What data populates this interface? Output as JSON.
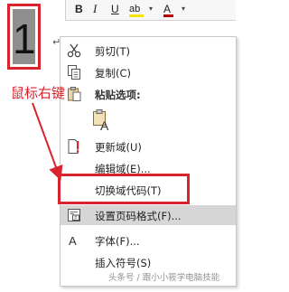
{
  "document": {
    "page_number": "1",
    "para_mark": "↵"
  },
  "mini_toolbar": {
    "bold": "B",
    "italic": "I",
    "underline": "U",
    "highlight": "ab",
    "dropdown": "▾",
    "font_color": "A"
  },
  "context_menu": {
    "items": [
      {
        "label": "剪切(T)",
        "icon": "scissors-icon"
      },
      {
        "label": "复制(C)",
        "icon": "copy-icon"
      },
      {
        "label": "粘贴选项:",
        "icon": "paste-icon"
      },
      {
        "label": "更新域(U)",
        "icon": "update-field-icon"
      },
      {
        "label": "编辑域(E)...",
        "icon": ""
      },
      {
        "label": "切换域代码(T)",
        "icon": ""
      },
      {
        "label": "设置页码格式(F)...",
        "icon": "page-number-format-icon"
      },
      {
        "label": "字体(F)...",
        "icon": "font-icon"
      },
      {
        "label": "插入符号(S)",
        "icon": ""
      }
    ],
    "paste_option_icon": "keep-text-only-icon"
  },
  "annotation": {
    "text": "鼠标右键",
    "color": "#d9232d"
  },
  "watermark": "头条号 / 跟小小筱学电脑技能"
}
